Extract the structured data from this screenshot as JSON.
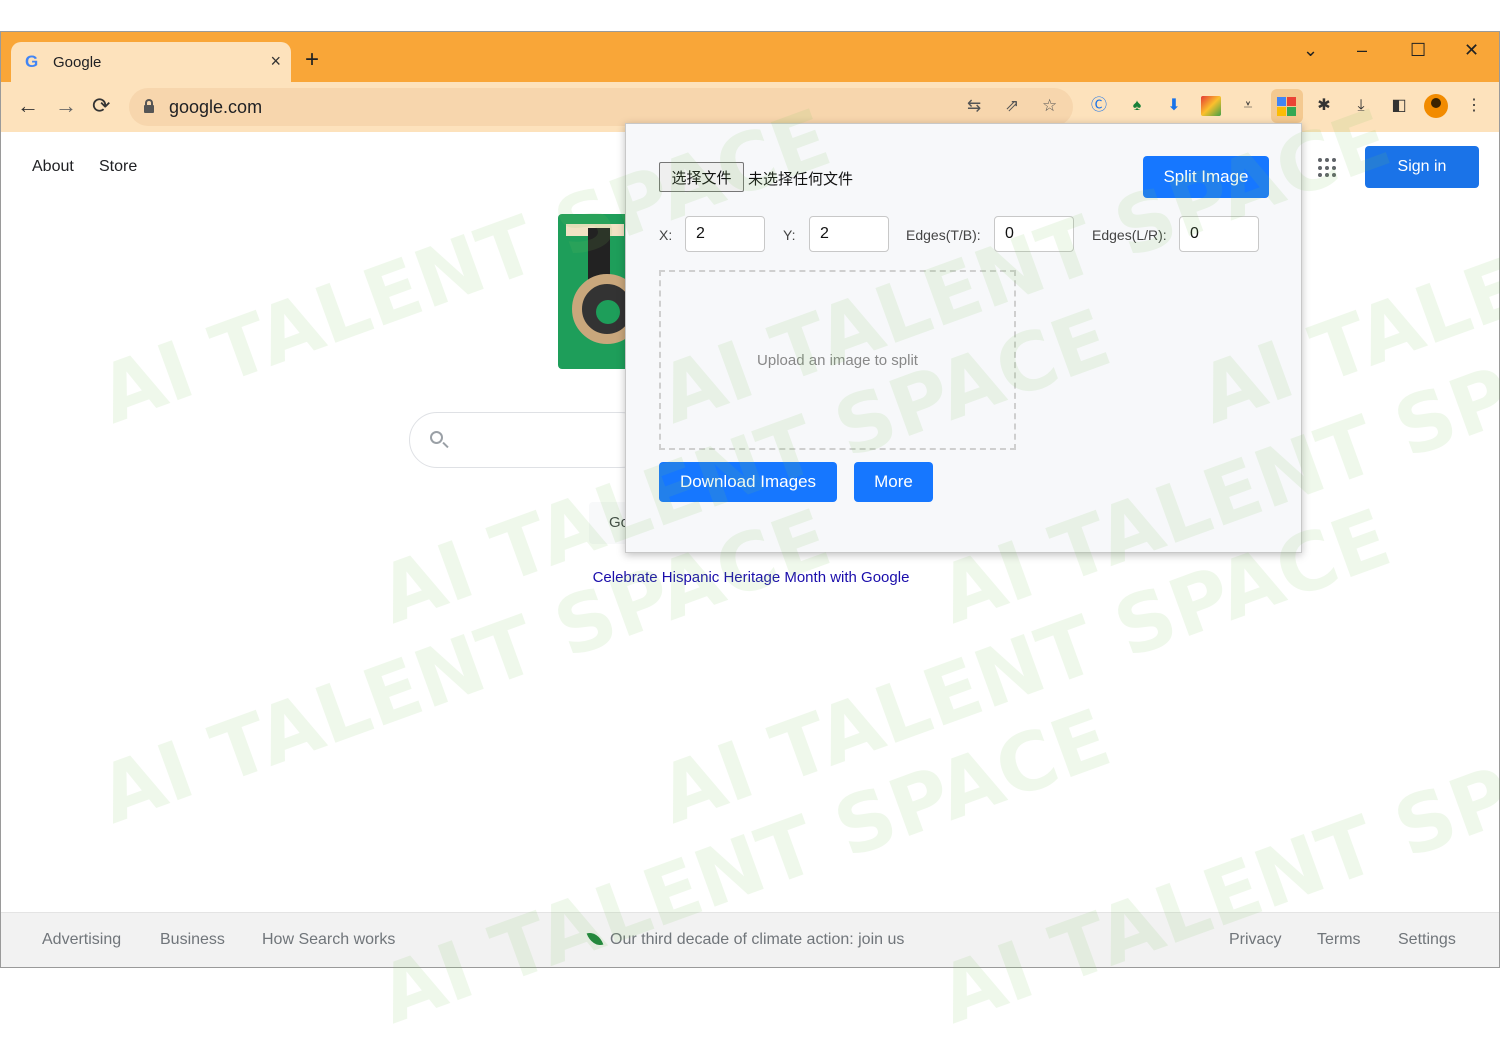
{
  "browser": {
    "tab": {
      "favicon": "G",
      "title": "Google",
      "close": "×"
    },
    "new_tab": "+",
    "window_controls": {
      "dropdown": "⌄",
      "minimize": "–",
      "maximize": "☐",
      "close": "✕"
    },
    "nav": {
      "back": "←",
      "forward": "→",
      "reload": "⟳"
    },
    "url": "google.com"
  },
  "google": {
    "top_links": [
      "About",
      "Store"
    ],
    "sign_in": "Sign in",
    "search_button_partial": "Go",
    "celebrate": "Celebrate Hispanic Heritage Month with Google"
  },
  "footer": {
    "left": [
      "Advertising",
      "Business",
      "How Search works"
    ],
    "center": "Our third decade of climate action: join us",
    "right": [
      "Privacy",
      "Terms",
      "Settings"
    ]
  },
  "popup": {
    "file_button": "选择文件",
    "file_status": "未选择任何文件",
    "split_button": "Split Image",
    "x_label": "X:",
    "x_value": "2",
    "y_label": "Y:",
    "y_value": "2",
    "edges_tb_label": "Edges(T/B):",
    "edges_tb_value": "0",
    "edges_lr_label": "Edges(L/R):",
    "edges_lr_value": "0",
    "dropzone_text": "Upload an image to split",
    "download_button": "Download Images",
    "more_button": "More"
  },
  "watermark": "AI TALENT SPACE",
  "colors": {
    "titlebar": "#f9a638",
    "toolbar": "#fde2bc",
    "accent": "#1677ff",
    "google_blue": "#1a73e8"
  }
}
